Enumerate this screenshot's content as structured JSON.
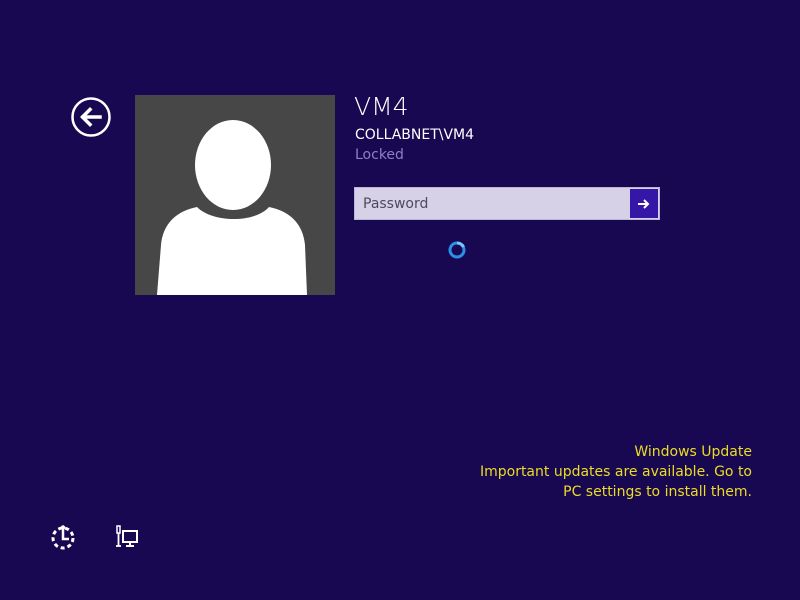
{
  "back_button": {
    "icon": "back-arrow-icon"
  },
  "user": {
    "avatar_icon": "user-silhouette-icon",
    "name": "VM4",
    "account": "COLLABNET\\VM4",
    "status": "Locked"
  },
  "password": {
    "value": "",
    "placeholder": "Password",
    "submit_icon": "arrow-right-icon"
  },
  "loading": {
    "icon": "spinner-icon"
  },
  "notification": {
    "title": "Windows Update",
    "line1": "Important updates are available. Go to",
    "line2": "PC settings to install them."
  },
  "bottom_bar": {
    "ease_of_access_icon": "ease-of-access-icon",
    "network_icon": "network-icon"
  },
  "colors": {
    "background": "#180852",
    "accent": "#3417a6",
    "notification_text": "#ecdc25",
    "status_text": "#8d7fcc"
  }
}
